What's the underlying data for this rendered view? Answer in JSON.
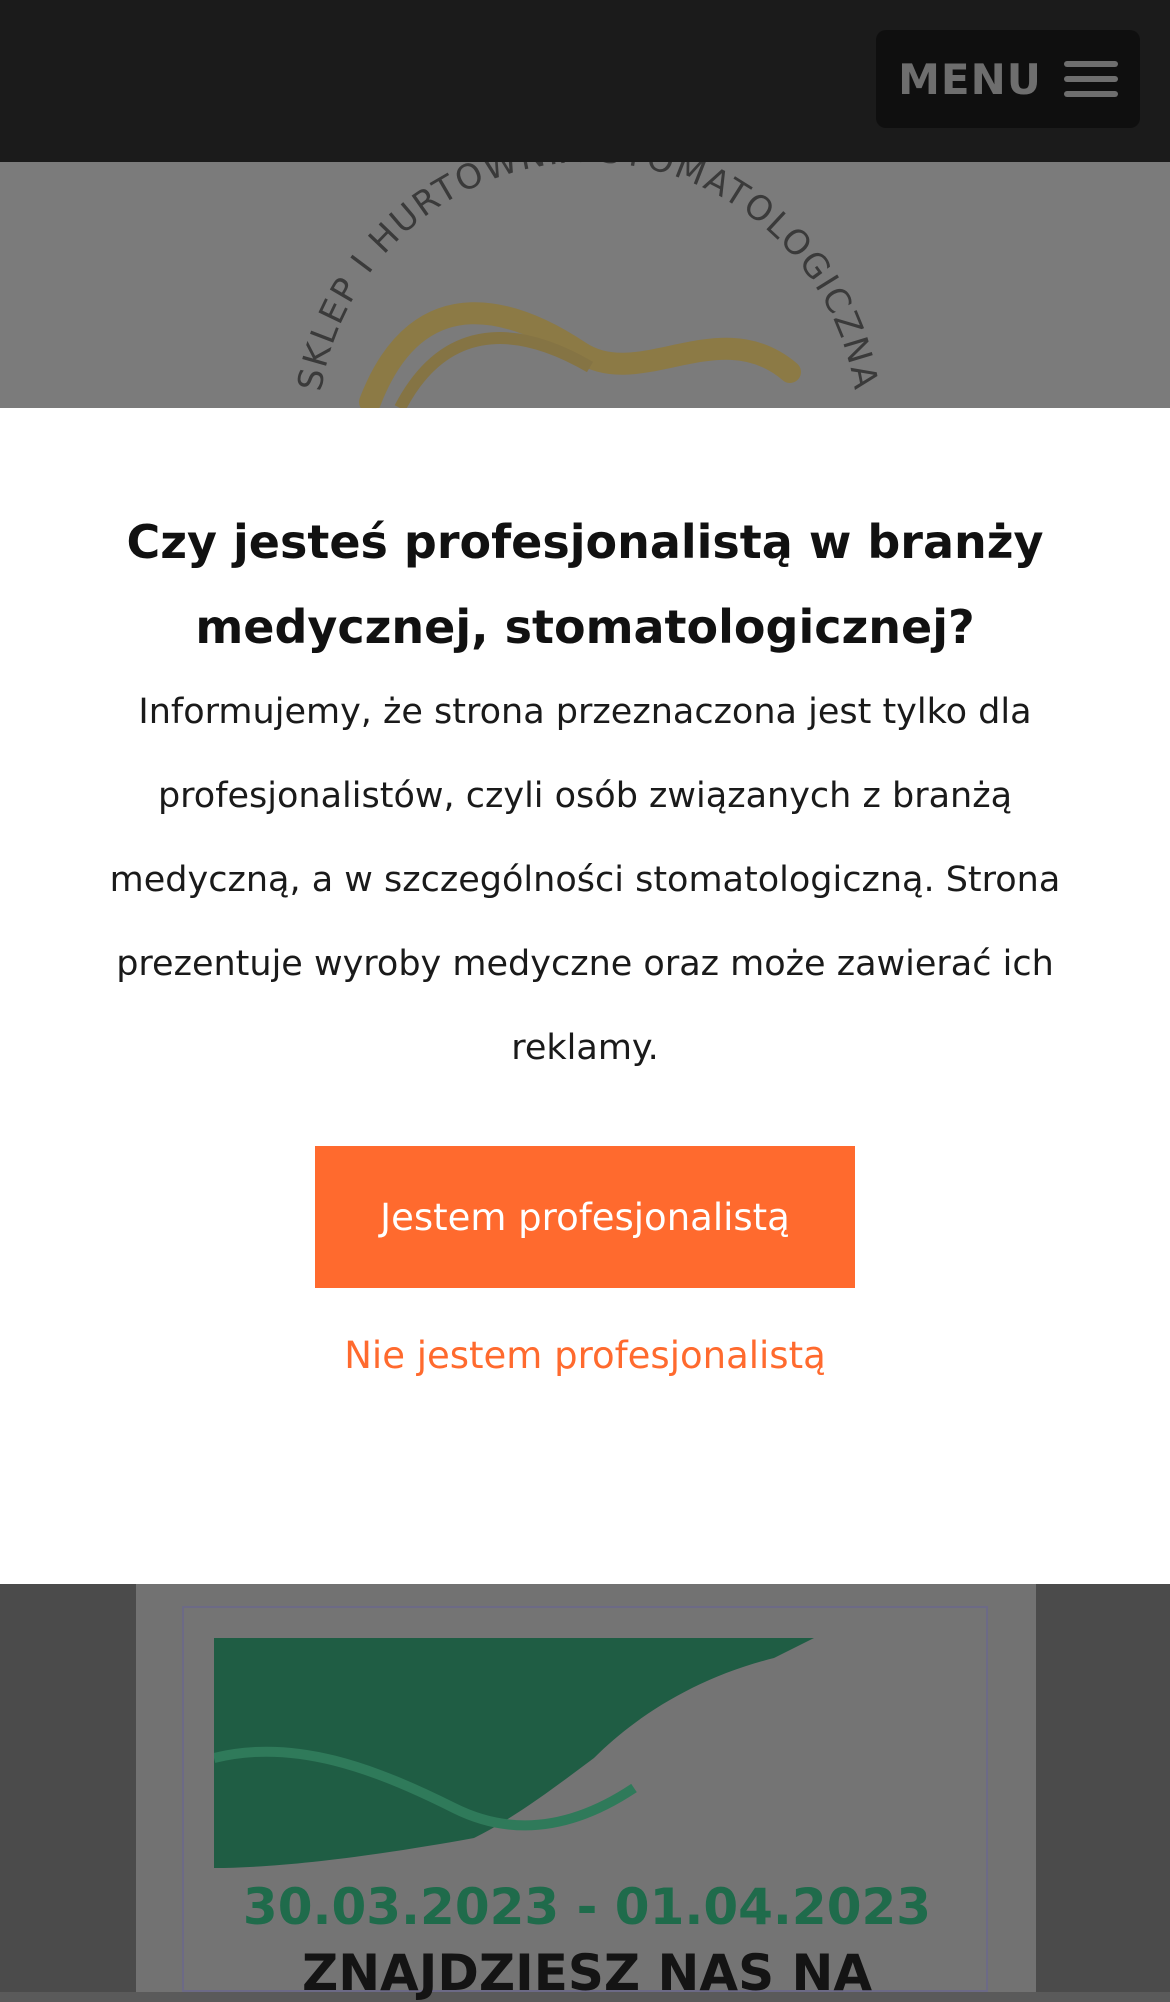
{
  "header": {
    "menu_label": "MENU"
  },
  "logo": {
    "arc_text": "SKLEP I HURTOWNIA STOMATOLOGICZNA"
  },
  "modal": {
    "title": "Czy jesteś profesjonalistą w branży medycznej, stomatologicznej?",
    "body": "Informujemy, że strona przeznaczona jest tylko dla profesjonalistów, czyli osób związanych z branżą medyczną, a w szczególności stomatologiczną. Strona prezentuje wyroby medyczne oraz może zawierać ich reklamy.",
    "accept_label": "Jestem profesjonalistą",
    "decline_label": "Nie jestem profesjonalistą"
  },
  "banner": {
    "dates": "30.03.2023 - 01.04.2023",
    "find_us": "ZNAJDZIESZ NAS NA"
  },
  "colors": {
    "accent": "#ff6a2e",
    "header_bg": "#1b1b1b",
    "banner_green": "#1f6b4b"
  }
}
